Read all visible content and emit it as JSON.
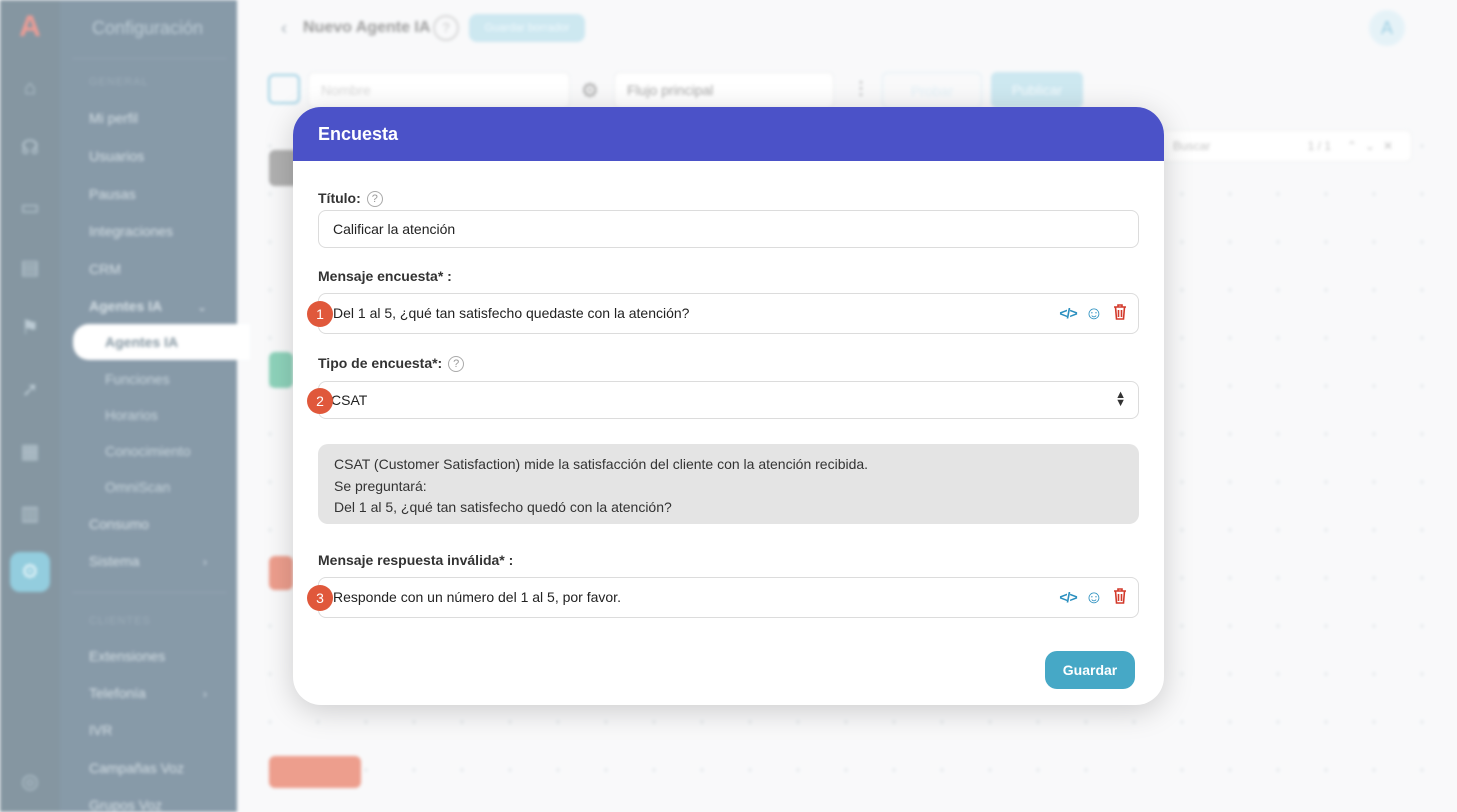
{
  "app": {
    "logo_text": "A",
    "sidebar_title": "Configuración",
    "groups": [
      "GENERAL",
      "CLIENTES"
    ],
    "menu_items": [
      "Mi perfil",
      "Usuarios",
      "Pausas",
      "Integraciones",
      "CRM",
      "Agentes IA"
    ],
    "submenu": [
      "Agentes IA",
      "Funciones",
      "Horarios",
      "Conocimiento",
      "OmniScan"
    ],
    "menu_items_2": [
      "Consumo",
      "Sistema"
    ],
    "menu_items_3": [
      "Extensiones",
      "Telefonía",
      "IVR",
      "Campañas Voz",
      "Grupos Voz"
    ],
    "active_submenu": "Agentes IA"
  },
  "topbar": {
    "back_icon": "chevron-left-icon",
    "agent_name": "Nuevo Agente IA",
    "help": "?",
    "badge": "Guardar borrador",
    "avatar": "A"
  },
  "toolbar": {
    "name_placeholder": "Nombre",
    "flow_select": "Flujo principal",
    "test_button": "Probar",
    "publish_button": "Publicar"
  },
  "canvas": {
    "search_placeholder": "Buscar",
    "search_count": "1 / 1"
  },
  "modal": {
    "title": "Encuesta",
    "titulo_label": "Título:",
    "titulo_value": "Calificar la atención",
    "mensaje_label": "Mensaje encuesta* :",
    "mensaje_value": "Del 1 al 5, ¿qué tan satisfecho quedaste con la atención?",
    "tipo_label": "Tipo de encuesta*:",
    "tipo_value": "CSAT",
    "info_line1": "CSAT (Customer Satisfaction) mide la satisfacción del cliente con la atención recibida.",
    "info_line2": "Se preguntará:",
    "info_line3": "Del 1 al 5, ¿qué tan satisfecho quedó con la atención?",
    "invalida_label": "Mensaje respuesta inválida* :",
    "invalida_value": "Responde con un número del 1 al 5, por favor.",
    "steps": [
      "1",
      "2",
      "3"
    ],
    "save_button": "Guardar"
  },
  "colors": {
    "header": "#4b52c8",
    "step_badge": "#e0583b",
    "save_button": "#46a8c6",
    "sidebar": "#31516a",
    "rail": "#2d4b5e"
  }
}
